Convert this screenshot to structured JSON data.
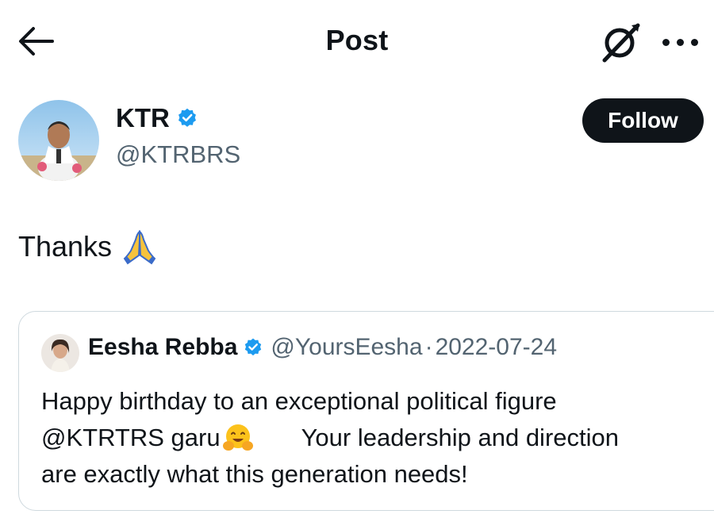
{
  "header": {
    "title": "Post",
    "back_icon": "arrow-left-icon",
    "grok_icon": "grok-icon",
    "more_icon": "more-horizontal-icon"
  },
  "author": {
    "name": "KTR",
    "handle": "@KTRBRS",
    "verified": true,
    "follow_label": "Follow"
  },
  "post": {
    "text": "Thanks",
    "emoji": "folded-hands-icon"
  },
  "quoted": {
    "name": "Eesha Rebba",
    "handle": "@YoursEesha",
    "separator": "·",
    "date": "2022-07-24",
    "verified": true,
    "line1": "Happy birthday to an exceptional political figure",
    "line2a": "@KTRTRS garu",
    "line2b": "Your leadership and direction",
    "line3": "are exactly what this generation needs!",
    "emoji": "hugging-face-icon"
  },
  "colors": {
    "text": "#0f1419",
    "secondary": "#536471",
    "verified": "#1d9bf0",
    "border": "#cfd9de"
  }
}
